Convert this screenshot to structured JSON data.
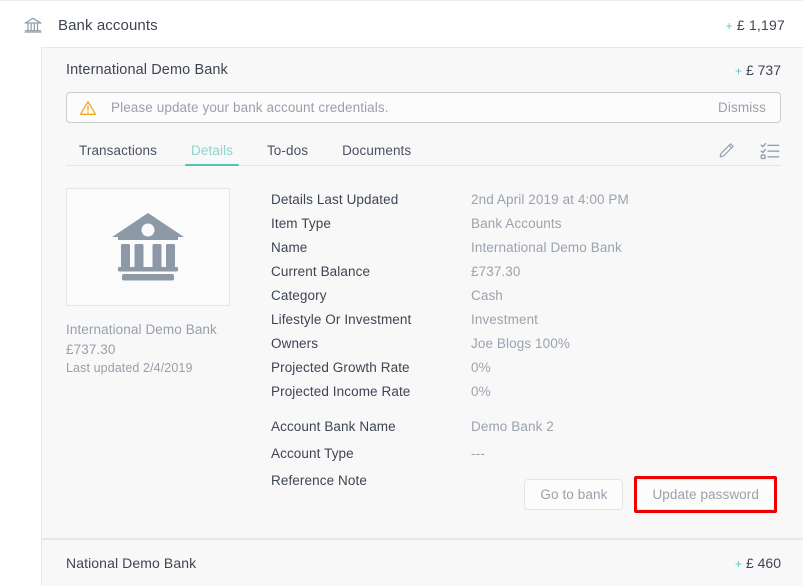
{
  "header": {
    "icon": "bank-icon",
    "title": "Bank accounts",
    "total_prefix": "+",
    "total_amount": "£ 1,197"
  },
  "account": {
    "name": "International Demo Bank",
    "amount_prefix": "+",
    "amount": "£ 737",
    "alert": {
      "icon": "warning-triangle-icon",
      "message": "Please update your bank account credentials.",
      "dismiss_label": "Dismiss"
    },
    "tabs": [
      {
        "label": "Transactions",
        "active": false
      },
      {
        "label": "Details",
        "active": true
      },
      {
        "label": "To-dos",
        "active": false
      },
      {
        "label": "Documents",
        "active": false
      }
    ],
    "tab_actions": [
      {
        "icon": "pencil-icon"
      },
      {
        "icon": "checklist-icon"
      }
    ],
    "thumbnail": {
      "icon": "bank-building-icon",
      "caption": "International Demo Bank £737.30",
      "subcaption": "Last updated 2/4/2019"
    },
    "details_primary": [
      {
        "label": "Details Last Updated",
        "value": "2nd April 2019 at 4:00 PM"
      },
      {
        "label": "Item Type",
        "value": "Bank Accounts"
      },
      {
        "label": "Name",
        "value": "International Demo Bank"
      },
      {
        "label": "Current Balance",
        "value": "£737.30"
      },
      {
        "label": "Category",
        "value": "Cash"
      },
      {
        "label": "Lifestyle Or Investment",
        "value": "Investment"
      },
      {
        "label": "Owners",
        "value": "Joe Blogs 100%"
      },
      {
        "label": "Projected Growth Rate",
        "value": "0%"
      },
      {
        "label": "Projected Income Rate",
        "value": "0%"
      }
    ],
    "details_secondary": [
      {
        "label": "Account Bank Name",
        "value": "Demo Bank 2"
      },
      {
        "label": "Account Type",
        "value": "---"
      },
      {
        "label": "Reference Note",
        "value": ""
      }
    ],
    "buttons": [
      {
        "label": "Go to bank",
        "highlighted": false
      },
      {
        "label": "Update password",
        "highlighted": true
      }
    ]
  },
  "next_account": {
    "name": "National Demo Bank",
    "amount_prefix": "+",
    "amount": "£ 460"
  },
  "colors": {
    "accent_teal": "#56c2b6",
    "accent_teal_light": "#8dd5cd",
    "warning_orange": "#f5a623",
    "icon_grey": "#8d99a6",
    "highlight_red": "#ee0000",
    "text_dark": "#3e4552",
    "text_muted": "#9aa3ae"
  }
}
